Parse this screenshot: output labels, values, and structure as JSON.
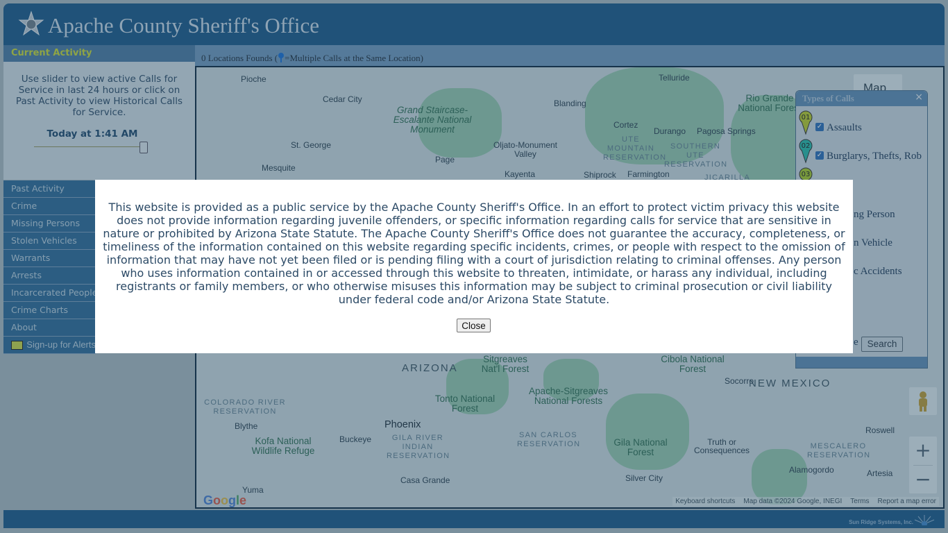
{
  "header": {
    "title": "Apache County Sheriff's Office",
    "logo_icon": "sheriff-star-badge-icon"
  },
  "sidebar": {
    "current_activity": {
      "heading": "Current Activity",
      "instructions": "Use slider to view active Calls for Service in last 24 hours or click on Past Activity to view Historical Calls for Service.",
      "time_label": "Today at 1:41 AM",
      "slider_value_fraction": 1.0
    },
    "nav": [
      {
        "label": "Past Activity"
      },
      {
        "label": "Crime"
      },
      {
        "label": "Missing Persons"
      },
      {
        "label": "Stolen Vehicles"
      },
      {
        "label": "Warrants"
      },
      {
        "label": "Arrests"
      },
      {
        "label": "Incarcerated People"
      },
      {
        "label": "Crime Charts"
      },
      {
        "label": "About"
      },
      {
        "label": "Sign-up for Alerts",
        "icon": "envelope-icon"
      }
    ]
  },
  "main": {
    "locations_prefix": "0 Locations Founds (",
    "locations_suffix": "=Multiple Calls at the Same Location)",
    "pin_color": "#1a6fd4"
  },
  "map": {
    "type_button": "Map",
    "labels": {
      "pioche": "Pioche",
      "cedar_city": "Cedar City",
      "st_george": "St. George",
      "mesquite": "Mesquite",
      "grand_staircase": "Grand Staircase-Escalante National Monument",
      "page": "Page",
      "oljato": "Oljato-Monument Valley",
      "kayenta": "Kayenta",
      "blanding": "Blanding",
      "telluride": "Telluride",
      "cortez": "Cortez",
      "durango": "Durango",
      "pagosa": "Pagosa Springs",
      "rio_grande": "Rio Grande National Forest",
      "ute_mountain": "UTE MOUNTAIN RESERVATION",
      "southern_ute": "SOUTHERN UTE RESERVATION",
      "shiprock": "Shiprock",
      "farmington": "Farmington",
      "jicarilla": "JICARILLA",
      "arizona": "ARIZONA",
      "sitgreaves": "Sitgreaves Nat'l Forest",
      "cibola": "Cibola National Forest",
      "socorro": "Socorro",
      "new_mexico": "NEW MEXICO",
      "tonto": "Tonto National Forest",
      "apache_sitgreaves": "Apache-Sitgreaves National Forests",
      "colorado_river": "COLORADO RIVER RESERVATION",
      "blythe": "Blythe",
      "kofa": "Kofa National Wildlife Refuge",
      "buckeye": "Buckeye",
      "phoenix": "Phoenix",
      "gila_river": "GILA RIVER INDIAN RESERVATION",
      "casa_grande": "Casa Grande",
      "yuma": "Yuma",
      "san_carlos": "SAN CARLOS RESERVATION",
      "gila_nf": "Gila National Forest",
      "truth": "Truth or Consequences",
      "silver_city": "Silver City",
      "mescalero": "MESCALERO RESERVATION",
      "alamogordo": "Alamogordo",
      "roswell": "Roswell",
      "artesia": "Artesia"
    },
    "zoom_in": "+",
    "zoom_out": "−",
    "attribution": {
      "shortcuts": "Keyboard shortcuts",
      "data": "Map data ©2024 Google, INEGI",
      "terms": "Terms",
      "report": "Report a map error"
    },
    "google_logo": "Google"
  },
  "types_panel": {
    "title": "Types of Calls",
    "close": "×",
    "items": [
      {
        "num": "01",
        "label": "Assaults",
        "checked": true,
        "color": "#b5c82e"
      },
      {
        "num": "02",
        "label": "Burglarys, Thefts, Rob",
        "checked": true,
        "color": "#29b7a9"
      },
      {
        "num": "03",
        "label": "",
        "checked": true,
        "color": "#a4c62e"
      }
    ],
    "partial_labels": [
      "ng Person",
      "n Vehicle",
      "c Accidents",
      "e"
    ],
    "search_button": "Search"
  },
  "footer": {
    "brand": "Sun Ridge Systems, Inc."
  },
  "modal": {
    "text": "This website is provided as a public service by the Apache County Sheriff's Office. In an effort to protect victim privacy this website does not provide information regarding juvenile offenders, or specific information regarding calls for service that are sensitive in nature or prohibited by Arizona State Statute. The Apache County Sheriff's Office does not guarantee the accuracy, completeness, or timeliness of the information contained on this website regarding specific incidents, crimes, or people with respect to the omission of information that may have not yet been filed or is pending filing with a court of jurisdiction relating to criminal offenses. Any person who uses information contained in or accessed through this website to threaten, intimidate, or harass any individual, including registrants or family members, or who otherwise misuses this information may be subject to criminal prosecution or civil liability under federal code and/or Arizona State Statute.",
    "close_button": "Close"
  }
}
